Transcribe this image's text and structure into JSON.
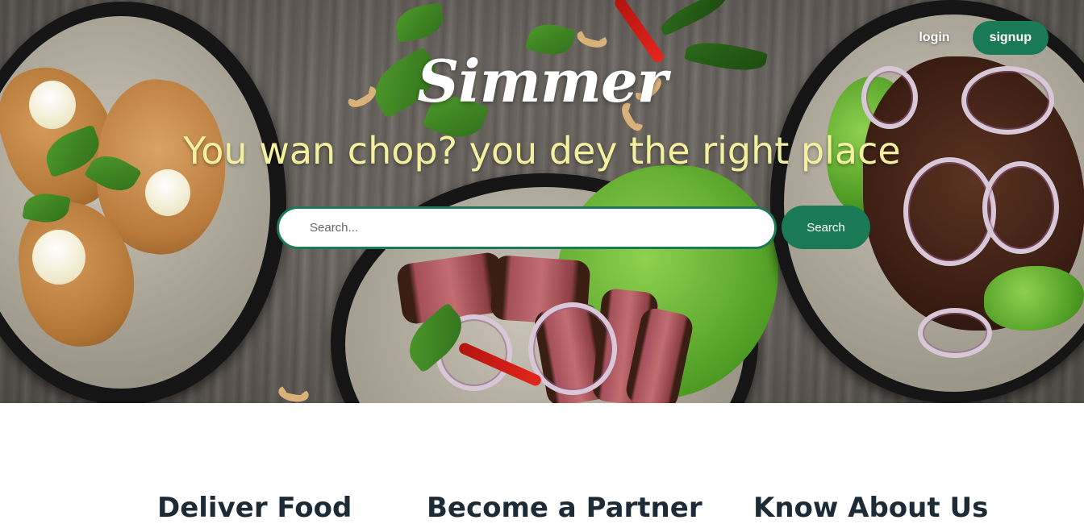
{
  "header": {
    "brand": "Simmer",
    "tagline": "You wan chop? you dey the right place",
    "nav": {
      "login_label": "login",
      "signup_label": "signup"
    }
  },
  "search": {
    "placeholder": "Search...",
    "value": "",
    "button_label": "Search"
  },
  "features": {
    "items": [
      {
        "label": "Deliver Food"
      },
      {
        "label": "Become a Partner"
      },
      {
        "label": "Know About Us"
      }
    ]
  },
  "colors": {
    "accent": "#1a7a56",
    "tagline": "#f5f0a0",
    "heading_text": "#1d2b36"
  }
}
